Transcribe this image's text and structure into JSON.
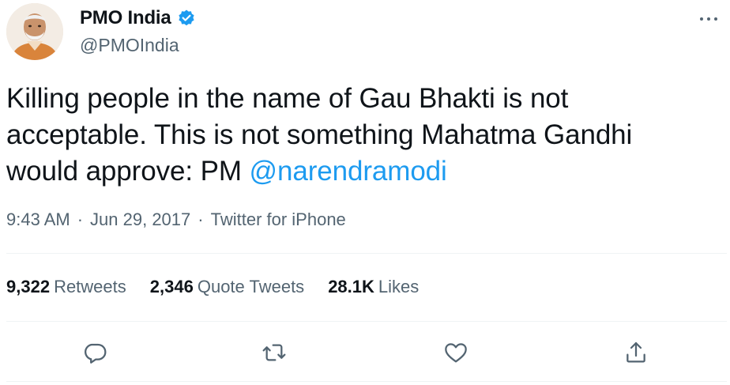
{
  "author": {
    "display_name": "PMO India",
    "handle": "@PMOIndia",
    "verified": true,
    "avatar_icon": "profile-photo"
  },
  "tweet": {
    "text_line1": "Killing people in the name of Gau Bhakti is not",
    "text_line2": "acceptable. This is not something Mahatma Gandhi",
    "text_line3_prefix": "would approve: PM ",
    "mention": "@narendramodi"
  },
  "meta": {
    "time": "9:43 AM",
    "separator": "·",
    "date": "Jun 29, 2017",
    "source": "Twitter for iPhone"
  },
  "stats": {
    "retweets_count": "9,322",
    "retweets_label": "Retweets",
    "quotes_count": "2,346",
    "quotes_label": "Quote Tweets",
    "likes_count": "28.1K",
    "likes_label": "Likes"
  },
  "actions": {
    "reply_icon": "reply-icon",
    "retweet_icon": "retweet-icon",
    "like_icon": "like-icon",
    "share_icon": "share-icon"
  },
  "colors": {
    "text_primary": "#0f1419",
    "text_secondary": "#536471",
    "link": "#1d9bf0",
    "divider": "#eff3f4"
  }
}
